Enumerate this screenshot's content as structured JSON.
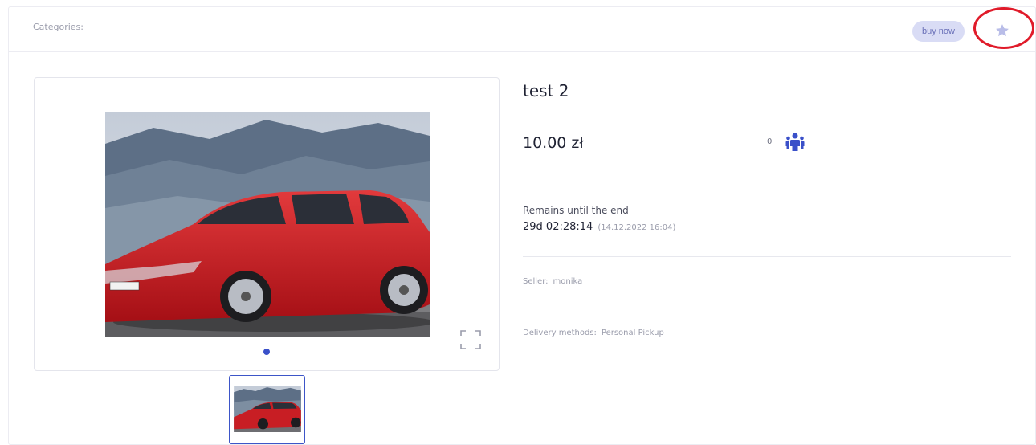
{
  "header": {
    "categories_label": "Categories:",
    "buy_now_label": "buy now",
    "favorite_icon": "star-icon"
  },
  "gallery": {
    "slide_count": 1,
    "active_slide": 1,
    "expand_icon": "fullscreen-icon",
    "thumbnail_count": 1
  },
  "item": {
    "title": "test 2",
    "price": "10.00 zł",
    "bidders_count": "0",
    "bidders_icon": "people-icon",
    "remains_label": "Remains until the end",
    "remains_time": "29d 02:28:14",
    "end_date": "(14.12.2022 16:04)",
    "seller_label": "Seller:",
    "seller_name": "monika",
    "delivery_label": "Delivery methods:",
    "delivery_value": "Personal Pickup"
  },
  "colors": {
    "accent": "#3a50c9",
    "buy_now_bg": "#d9dcf5",
    "highlight": "#e01b2a",
    "star": "#b9bde8"
  }
}
